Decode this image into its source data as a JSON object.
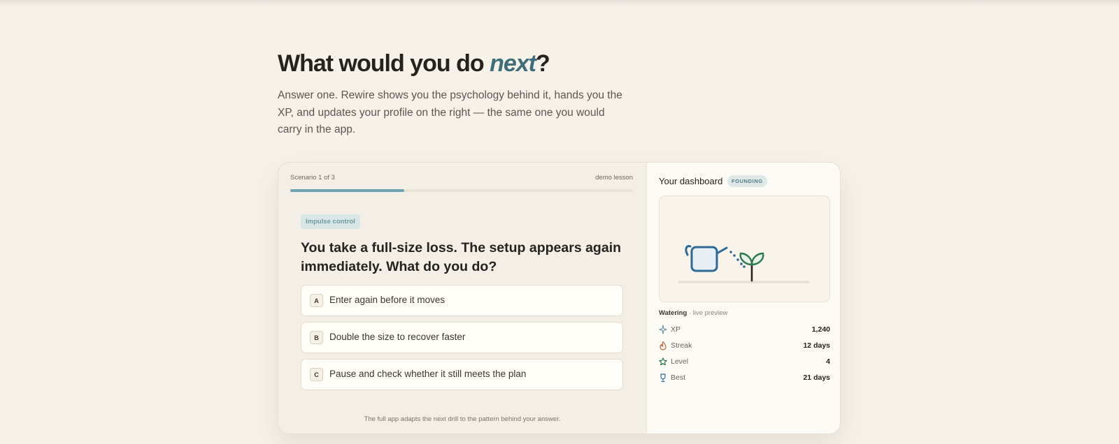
{
  "heading": {
    "prefix": "What would you do ",
    "emphasis": "next",
    "suffix": "?"
  },
  "lede": "Answer one. Rewire shows you the psychology behind it, hands you the XP, and updates your profile on the right — the same one you would carry in the app.",
  "lesson": {
    "scenario_label": "Scenario 1 of 3",
    "mode_label": "demo lesson",
    "progress_fraction": 0.333,
    "tag": "Impulse control",
    "question": "You take a full-size loss. The setup appears again immediately. What do you do?",
    "options": [
      {
        "key": "A",
        "label": "Enter again before it moves"
      },
      {
        "key": "B",
        "label": "Double the size to recover faster"
      },
      {
        "key": "C",
        "label": "Pause and check whether it still meets the plan"
      }
    ],
    "footnote": "The full app adapts the next drill to the pattern behind your answer."
  },
  "dashboard": {
    "title": "Your dashboard",
    "badge": "FOUNDING",
    "illustration": "watering-can-and-sprout",
    "caption_bold": "Watering",
    "caption_rest": " · live preview",
    "stats": [
      {
        "icon": "sparkle-icon",
        "name": "XP",
        "value": "1,240"
      },
      {
        "icon": "flame-icon",
        "name": "Streak",
        "value": "12 days"
      },
      {
        "icon": "star-icon",
        "name": "Level",
        "value": "4"
      },
      {
        "icon": "trophy-icon",
        "name": "Best",
        "value": "21 days"
      }
    ]
  },
  "colors": {
    "background": "#f6f2ea",
    "accent": "#3f6e7a",
    "progress": "#6ea3b3",
    "plant": "#2f7a4a",
    "can": "#2e6a95"
  }
}
